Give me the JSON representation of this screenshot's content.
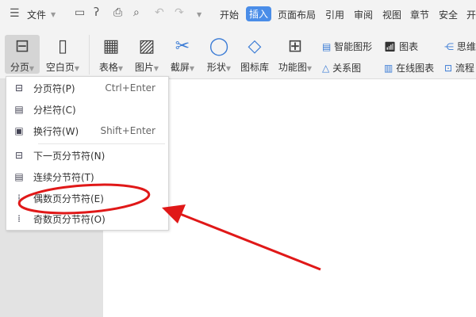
{
  "topbar": {
    "file_label": "文件",
    "tabs": [
      "开始",
      "插入",
      "页面布局",
      "引用",
      "审阅",
      "视图",
      "章节",
      "安全",
      "开"
    ],
    "active_tab": "插入"
  },
  "ribbon": {
    "buttons": [
      {
        "label": "分页",
        "icon": "page-break-icon"
      },
      {
        "label": "空白页",
        "icon": "blank-page-icon"
      },
      {
        "label": "表格",
        "icon": "table-icon"
      },
      {
        "label": "图片",
        "icon": "picture-icon"
      },
      {
        "label": "截屏",
        "icon": "screenshot-icon"
      },
      {
        "label": "形状",
        "icon": "shapes-icon"
      },
      {
        "label": "图标库",
        "icon": "icon-library-icon"
      },
      {
        "label": "功能图",
        "icon": "function-chart-icon"
      }
    ],
    "small": [
      "智能图形",
      "图表",
      "思维",
      "关系图",
      "在线图表",
      "流程"
    ]
  },
  "menu": {
    "items": [
      {
        "label": "分页符(P)",
        "shortcut": "Ctrl+Enter"
      },
      {
        "label": "分栏符(C)",
        "shortcut": ""
      },
      {
        "label": "换行符(W)",
        "shortcut": "Shift+Enter"
      },
      {
        "label": "下一页分节符(N)",
        "shortcut": ""
      },
      {
        "label": "连续分节符(T)",
        "shortcut": ""
      },
      {
        "label": "偶数页分节符(E)",
        "shortcut": ""
      },
      {
        "label": "奇数页分节符(O)",
        "shortcut": ""
      }
    ]
  },
  "annotation": {
    "color": "#e01818"
  }
}
